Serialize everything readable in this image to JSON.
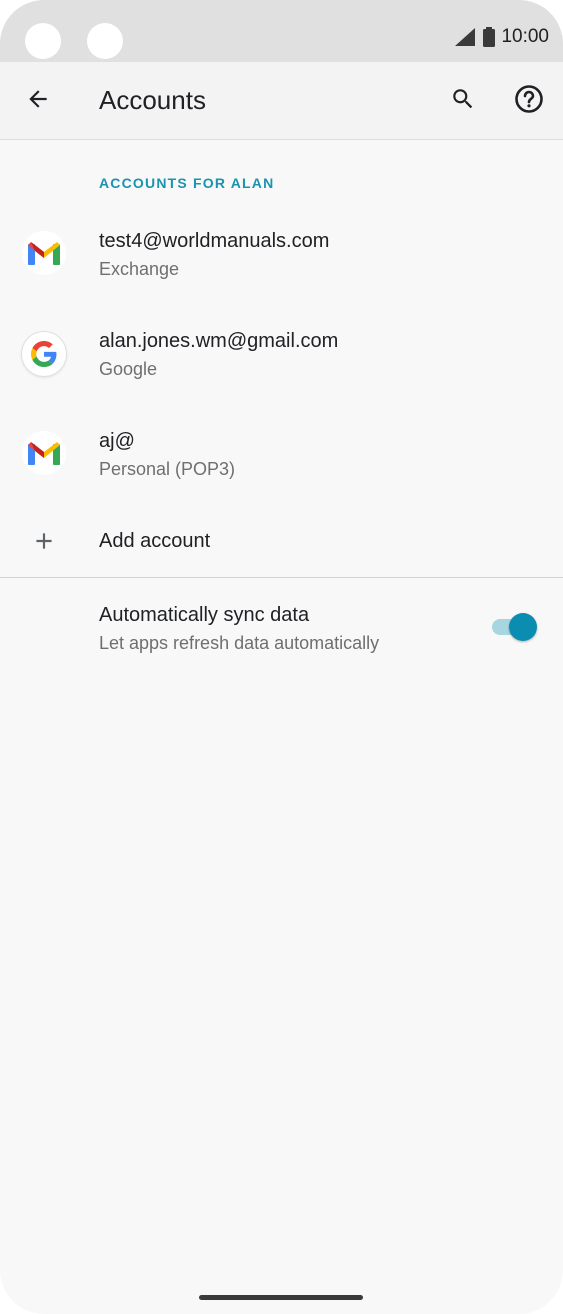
{
  "status_bar": {
    "time": "10:00",
    "signal_icon": "signal-icon",
    "battery_icon": "battery-icon"
  },
  "app_bar": {
    "title": "Accounts",
    "back_icon": "arrow-back-icon",
    "search_icon": "search-icon",
    "help_icon": "help-icon"
  },
  "section": {
    "header": "ACCOUNTS FOR ALAN"
  },
  "accounts": [
    {
      "email": "test4@worldmanuals.com",
      "type": "Exchange",
      "icon": "gmail-icon"
    },
    {
      "email": "alan.jones.wm@gmail.com",
      "type": "Google",
      "icon": "google-icon"
    },
    {
      "email": "aj@",
      "type": "Personal (POP3)",
      "icon": "gmail-icon"
    }
  ],
  "add_account": {
    "label": "Add account",
    "icon": "plus-icon"
  },
  "auto_sync": {
    "title": "Automatically sync data",
    "subtitle": "Let apps refresh data automatically",
    "enabled": true
  },
  "colors": {
    "accent": "#1a93b0",
    "toggle_thumb": "#0b8db2",
    "toggle_track": "#a8d6e0"
  }
}
